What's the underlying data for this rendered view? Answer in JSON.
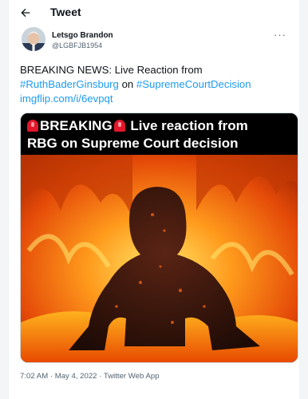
{
  "header": {
    "title": "Tweet",
    "back_icon": "back-arrow-icon"
  },
  "author": {
    "name": "Letsgo Brandon",
    "handle": "@LGBFJB1954"
  },
  "tweet": {
    "line1": "BREAKING NEWS: Live Reaction from",
    "hashtag1": "#RuthBaderGinsburg",
    "on": "on",
    "hashtag2": "#SupremeCourtDecision",
    "link": "imgflip.com/i/6evpqt"
  },
  "meme": {
    "breaking": "BREAKING",
    "line1_rest": " Live reaction from",
    "line2": "RBG on Supreme Court decision",
    "colors": {
      "fire_dark": "#b32200",
      "fire_bright": "#ffd23a"
    }
  },
  "meta": {
    "timestamp": "7:02 AM · May 4, 2022 · Twitter Web App"
  },
  "colors": {
    "link": "#1d9bf0",
    "text": "#0f1419",
    "muted": "#536471"
  }
}
